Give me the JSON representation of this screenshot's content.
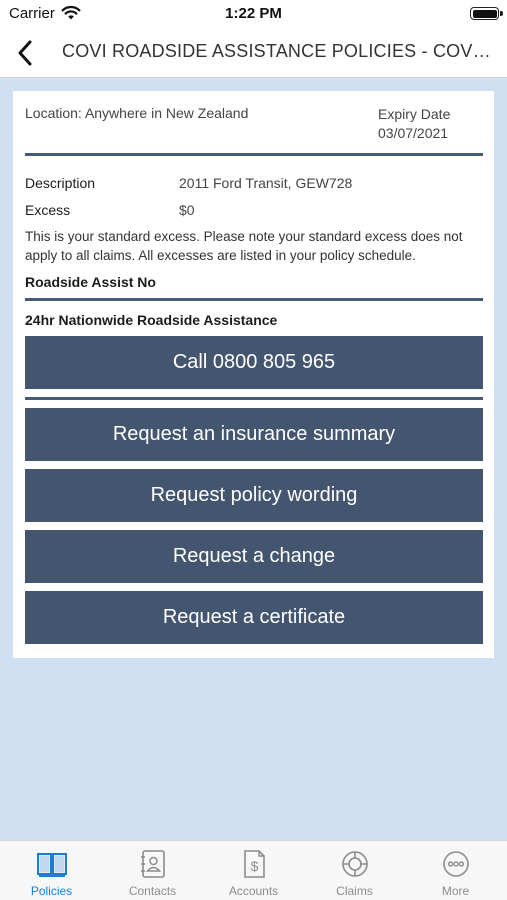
{
  "status_bar": {
    "carrier": "Carrier",
    "time": "1:22 PM"
  },
  "nav": {
    "title": "COVI ROADSIDE ASSISTANCE POLICIES - COVI SUPPORT",
    "back_icon": "chevron-left-icon"
  },
  "policy": {
    "location": "Location: Anywhere in New Zealand",
    "expiry_label": "Expiry Date",
    "expiry_date": "03/07/2021",
    "description_label": "Description",
    "description_value": "2011 Ford Transit, GEW728",
    "excess_label": "Excess",
    "excess_value": "$0",
    "excess_note": "This is your standard excess. Please note your standard excess does not apply to all claims.  All excesses are listed in your policy schedule.",
    "roadside_label": "Roadside Assist No",
    "nationwide_label": "24hr Nationwide Roadside Assistance"
  },
  "actions": {
    "call": "Call 0800 805 965",
    "insurance_summary": "Request an insurance summary",
    "policy_wording": "Request policy wording",
    "change": "Request a change",
    "certificate": "Request a certificate"
  },
  "tabs": [
    {
      "label": "Policies",
      "icon": "book-icon",
      "active": true
    },
    {
      "label": "Contacts",
      "icon": "contact-card-icon",
      "active": false
    },
    {
      "label": "Accounts",
      "icon": "dollar-document-icon",
      "active": false
    },
    {
      "label": "Claims",
      "icon": "lifebuoy-icon",
      "active": false
    },
    {
      "label": "More",
      "icon": "more-icon",
      "active": false
    }
  ],
  "colors": {
    "accent": "#1b7ed6",
    "button": "#44566f",
    "background": "#cfe0f2",
    "inactive_tab": "#8c8c8c"
  }
}
